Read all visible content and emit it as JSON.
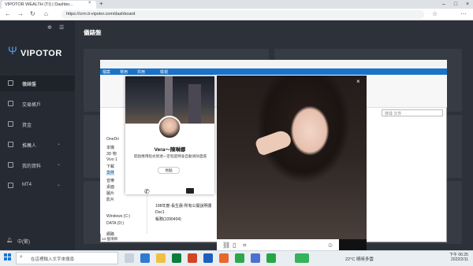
{
  "browser": {
    "tab_title": "VIPOTOR WEALTH (TI) | Dashbo...",
    "url": "https://crm.ti-vipotor.com/dashboard"
  },
  "sidebar": {
    "logo": "VIPOTOR",
    "items": [
      {
        "label": "儀錶盤",
        "active": true
      },
      {
        "label": "交易帳戶"
      },
      {
        "label": "資金"
      },
      {
        "label": "推薦人",
        "expandable": true
      },
      {
        "label": "我的資料",
        "expandable": true
      },
      {
        "label": "MT4",
        "expandable": true
      }
    ],
    "language": "中(繁)"
  },
  "main": {
    "title": "儀錶盤"
  },
  "explorer": {
    "ribbon_tabs": [
      "檔案",
      "常用",
      "共用",
      "檢視"
    ],
    "search_placeholder": "搜尋 文件",
    "nav": [
      "OneDri",
      "本機",
      "3D 物",
      "Vivo 1",
      "下載",
      "文件",
      "音樂",
      "桌面",
      "圖片",
      "影片",
      "Windows (C:)",
      "DATA (D:)",
      "網路"
    ],
    "files": [
      "108年度-長生晨-所有公開說明書",
      "Doc1",
      "帳務(1090404)"
    ],
    "status": "14 個項目"
  },
  "contact": {
    "name": "Vera～陳琳娜",
    "status": "開啟應用程式到達一定程度時會自動清除遺漏",
    "location": "地點"
  },
  "taskbar": {
    "search_placeholder": "在這裡輸入文字來搜尋",
    "weather": "22°C 晴時多雲",
    "time": "下午 06:25",
    "date": "2022/2/11"
  }
}
